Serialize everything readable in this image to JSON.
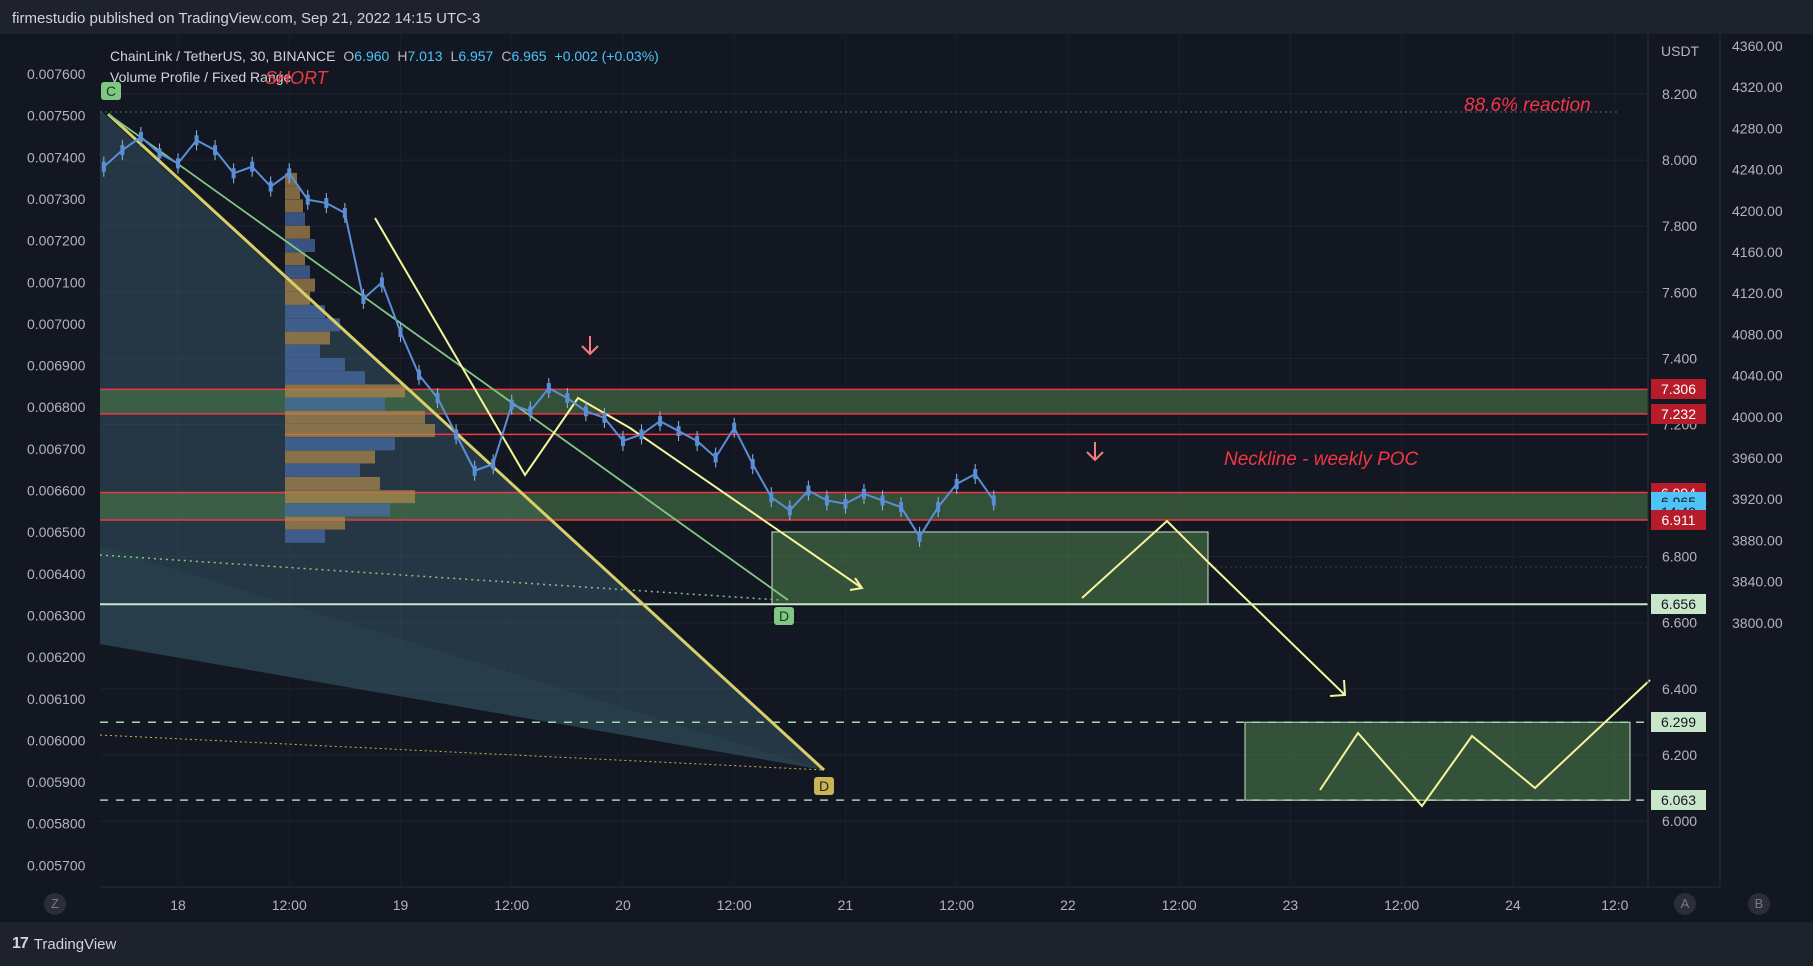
{
  "header": {
    "published": "firmestudio published on TradingView.com, Sep 21, 2022 14:15 UTC-3"
  },
  "legend": {
    "symbol": "ChainLink / TetherUS, 30, BINANCE",
    "o_label": "O",
    "o": "6.960",
    "h_label": "H",
    "h": "7.013",
    "l_label": "L",
    "l": "6.957",
    "c_label": "C",
    "c": "6.965",
    "change": "+0.002 (+0.03%)",
    "indicator": "Volume Profile / Fixed Range"
  },
  "annotations": {
    "short": "SHORT",
    "reaction": "88.6% reaction",
    "neckline": "Neckline - weekly POC"
  },
  "pattern_points": {
    "c": "C",
    "d1": "D",
    "d2": "D"
  },
  "axis": {
    "currency": "USDT"
  },
  "price_badges": [
    {
      "label": "7.306",
      "value": 7.306,
      "color": "#b71c2a"
    },
    {
      "label": "7.232",
      "value": 7.232,
      "color": "#b71c2a"
    },
    {
      "label": "6.994",
      "value": 6.994,
      "color": "#b71c2a"
    },
    {
      "label": "6.965",
      "value": 6.965,
      "color": "#4fc3f7"
    },
    {
      "label": "14:49",
      "value": 6.935,
      "color": "#4fc3f7"
    },
    {
      "label": "6.911",
      "value": 6.911,
      "color": "#b71c2a"
    },
    {
      "label": "6.656",
      "value": 6.656,
      "color": "#c8e6c9"
    },
    {
      "label": "6.299",
      "value": 6.299,
      "color": "#c8e6c9"
    },
    {
      "label": "6.063",
      "value": 6.063,
      "color": "#c8e6c9"
    }
  ],
  "footer": {
    "brand": "TradingView",
    "z": "Z",
    "a": "A",
    "b": "B"
  },
  "chart_data": {
    "type": "line",
    "title": "ChainLink / TetherUS, 30, BINANCE",
    "y_main_ticks": [
      "8.200",
      "8.000",
      "7.800",
      "7.600",
      "7.400",
      "7.200",
      "6.800",
      "6.600",
      "6.400",
      "6.200",
      "6.000"
    ],
    "y_main_values": [
      8.2,
      8.0,
      7.8,
      7.6,
      7.4,
      7.2,
      6.8,
      6.6,
      6.4,
      6.2,
      6.0
    ],
    "y_main_range": [
      5.9,
      8.33
    ],
    "y_left_ticks": [
      "0.007600",
      "0.007500",
      "0.007400",
      "0.007300",
      "0.007200",
      "0.007100",
      "0.007000",
      "0.006900",
      "0.006800",
      "0.006700",
      "0.006600",
      "0.006500",
      "0.006400",
      "0.006300",
      "0.006200",
      "0.006100",
      "0.006000",
      "0.005900",
      "0.005800",
      "0.005700"
    ],
    "y_right_ticks": [
      "4360.00",
      "4320.00",
      "4280.00",
      "4240.00",
      "4200.00",
      "4160.00",
      "4120.00",
      "4080.00",
      "4040.00",
      "4000.00",
      "3960.00",
      "3920.00",
      "3880.00",
      "3840.00",
      "3800.00"
    ],
    "x_ticks": [
      "18",
      "12:00",
      "19",
      "12:00",
      "20",
      "12:00",
      "21",
      "12:00",
      "22",
      "12:00",
      "23",
      "12:00",
      "24",
      "12:0"
    ],
    "x_range_hours": [
      -16,
      150
    ],
    "x_tick_hours": [
      0,
      12,
      24,
      36,
      48,
      60,
      72,
      84,
      96,
      108,
      120,
      132,
      144,
      155
    ],
    "series": [
      {
        "x": [
          -8,
          -6,
          -4,
          -2,
          0,
          2,
          4,
          6,
          8,
          10,
          12,
          14,
          16,
          18,
          20,
          22,
          24,
          26,
          28,
          30,
          32,
          34,
          36,
          38,
          40,
          42,
          44,
          46,
          48,
          50,
          52,
          54,
          56,
          58,
          60,
          62,
          64,
          66,
          68,
          70,
          72,
          74,
          76,
          78,
          80,
          82,
          84,
          86,
          88
        ],
        "y": [
          7.98,
          8.03,
          8.07,
          8.02,
          7.99,
          8.06,
          8.03,
          7.96,
          7.98,
          7.92,
          7.96,
          7.88,
          7.87,
          7.84,
          7.58,
          7.63,
          7.48,
          7.35,
          7.28,
          7.17,
          7.06,
          7.08,
          7.26,
          7.24,
          7.31,
          7.28,
          7.24,
          7.22,
          7.15,
          7.17,
          7.21,
          7.18,
          7.15,
          7.1,
          7.19,
          7.08,
          6.98,
          6.94,
          7.0,
          6.97,
          6.96,
          6.99,
          6.97,
          6.95,
          6.86,
          6.95,
          7.02,
          7.05,
          6.97
        ]
      }
    ],
    "levels": [
      7.306,
      7.232,
      7.17,
      6.994,
      6.911,
      6.656,
      6.299,
      6.063
    ]
  }
}
